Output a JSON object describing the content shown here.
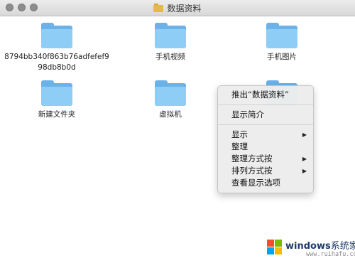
{
  "window": {
    "title": "数据资料"
  },
  "items": [
    {
      "label": "8794bb340f863b76adfefef998db8b0d"
    },
    {
      "label": "手机视频"
    },
    {
      "label": "手机图片"
    },
    {
      "label": "新建文件夹"
    },
    {
      "label": "虚拟机"
    },
    {
      "label": ""
    }
  ],
  "context_menu": {
    "items": [
      {
        "label": "推出“数据资料”"
      },
      {
        "label": "显示简介"
      },
      {
        "label": "显示",
        "submenu": true
      },
      {
        "label": "整理"
      },
      {
        "label": "整理方式按",
        "submenu": true
      },
      {
        "label": "排列方式按",
        "submenu": true
      },
      {
        "label": "查看显示选项"
      }
    ],
    "submenu_arrow": "▶"
  },
  "watermark": {
    "brand": "windows",
    "brand_suffix": "系统家园",
    "url": "www.ruihafu.com"
  },
  "colors": {
    "folder_front": "#8ecdf6",
    "folder_back": "#6ab2e8",
    "menu_bg": "#ececec",
    "logo": [
      "#f25022",
      "#7fba00",
      "#00a4ef",
      "#ffb900"
    ]
  }
}
